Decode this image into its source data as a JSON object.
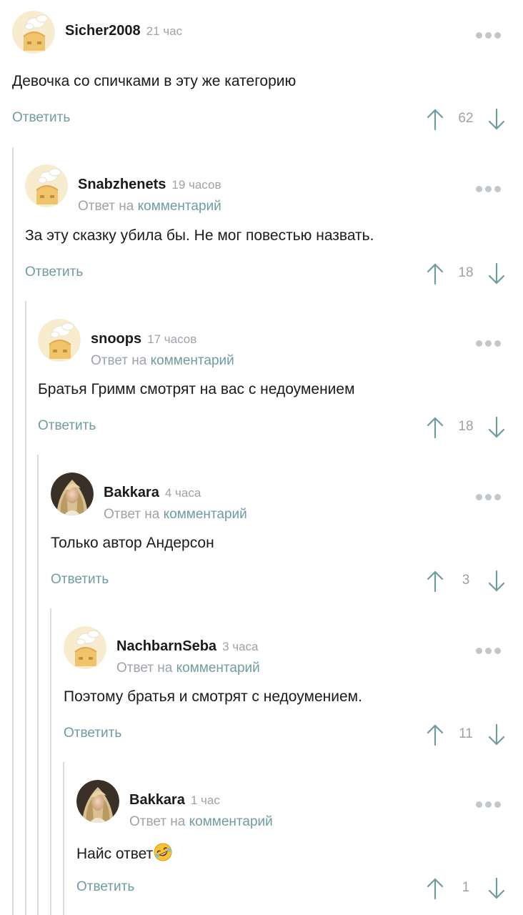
{
  "comments": [
    {
      "username": "Sicher2008",
      "time": "21 час",
      "reply_prefix": "",
      "reply_link": "",
      "text": "Девочка со спичками в эту же категорию",
      "reply_label": "Ответить",
      "score": "62",
      "avatar": "default-avatar-icon"
    },
    {
      "username": "Snabzhenets",
      "time": "19 часов",
      "reply_prefix": "Ответ на ",
      "reply_link": "комментарий",
      "text": "За эту сказку убила бы. Не мог повестью назвать.",
      "reply_label": "Ответить",
      "score": "18",
      "avatar": "default-avatar-icon"
    },
    {
      "username": "snoops",
      "time": "17 часов",
      "reply_prefix": "Ответ на ",
      "reply_link": "комментарий",
      "text": "Братья Гримм смотрят на вас с недоумением",
      "reply_label": "Ответить",
      "score": "18",
      "avatar": "default-avatar-icon"
    },
    {
      "username": "Bakkara",
      "time": "4 часа",
      "reply_prefix": "Ответ на ",
      "reply_link": "комментарий",
      "text": "Только автор Андерсон",
      "reply_label": "Ответить",
      "score": "3",
      "avatar": "photo-avatar"
    },
    {
      "username": "NachbarnSeba",
      "time": "3 часа",
      "reply_prefix": "Ответ на ",
      "reply_link": "комментарий",
      "text": "Поэтому братья и смотрят с недоумением.",
      "reply_label": "Ответить",
      "score": "11",
      "avatar": "default-avatar-icon"
    },
    {
      "username": "Bakkara",
      "time": "1 час",
      "reply_prefix": "Ответ на ",
      "reply_link": "комментарий",
      "text": "Найс ответ",
      "text_emoji": "rolling-on-floor-laughing-emoji",
      "reply_label": "Ответить",
      "score": "1",
      "avatar": "photo-avatar"
    }
  ],
  "colors": {
    "accent": "#6f9c9f",
    "muted": "#9da3a8",
    "thread_line": "#d9dcdf",
    "avatar_bg": "#f8eccf"
  }
}
